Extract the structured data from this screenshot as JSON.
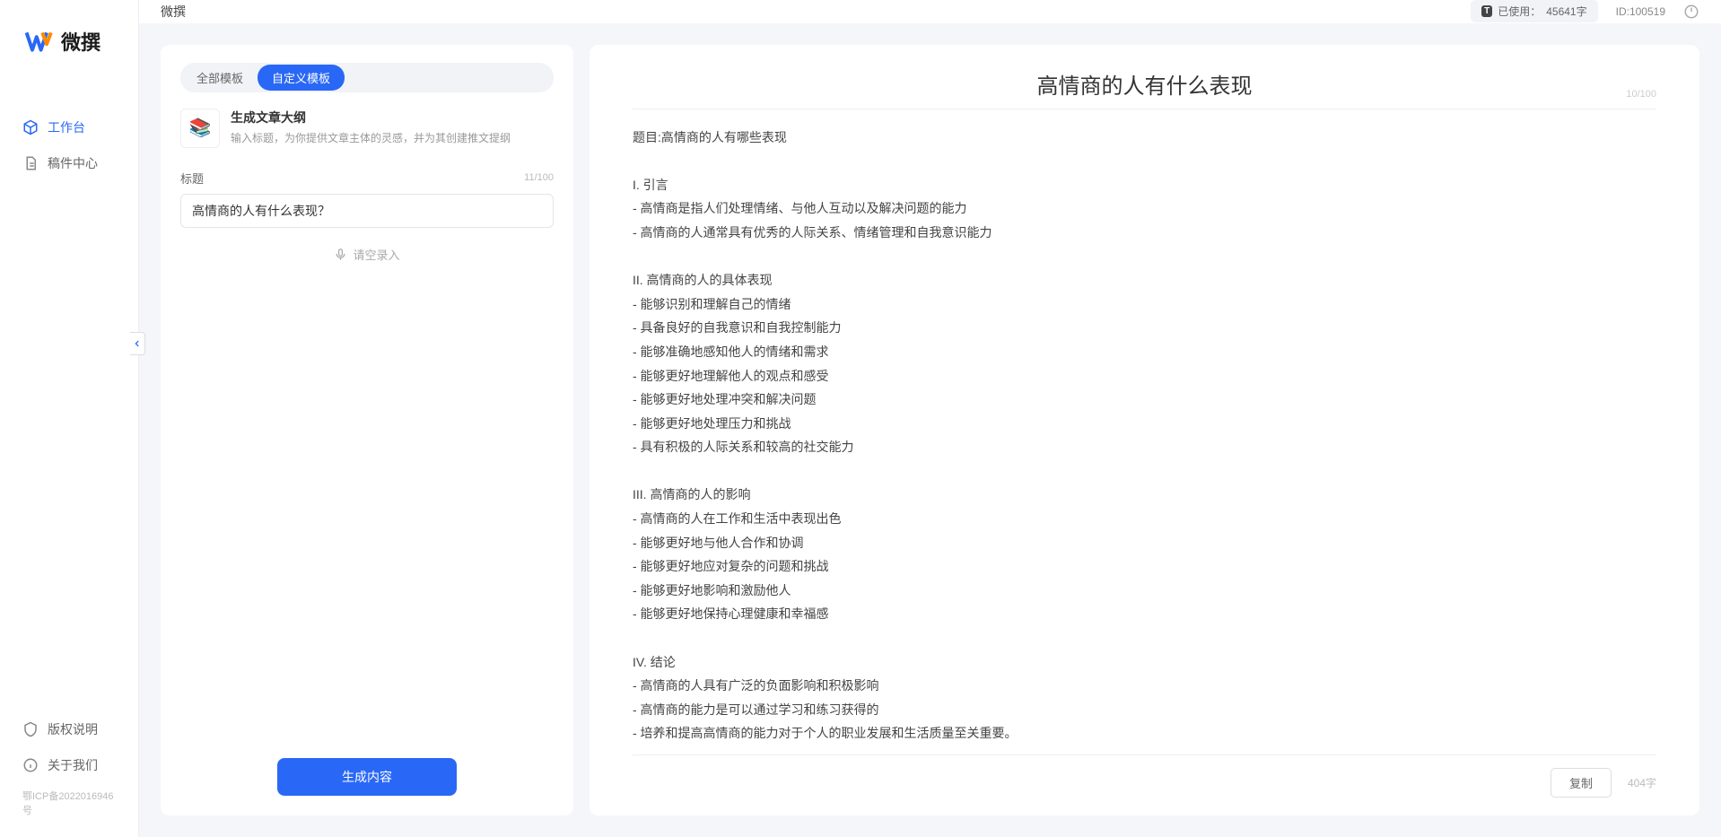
{
  "brand": {
    "name": "微撰"
  },
  "sidebar": {
    "items": [
      {
        "label": "工作台",
        "active": true
      },
      {
        "label": "稿件中心",
        "active": false
      }
    ],
    "bottom": [
      {
        "label": "版权说明"
      },
      {
        "label": "关于我们"
      }
    ],
    "icp": "鄂ICP备2022016946号"
  },
  "topbar": {
    "title": "微撰",
    "usage_label": "已使用：",
    "usage_value": "45641字",
    "uid_label": "ID:",
    "uid_value": "100519"
  },
  "left": {
    "tabs": [
      {
        "label": "全部模板",
        "active": false
      },
      {
        "label": "自定义模板",
        "active": true
      }
    ],
    "template": {
      "icon": "📚",
      "title": "生成文章大纲",
      "desc": "输入标题，为你提供文章主体的灵感，并为其创建推文提纲"
    },
    "field_label": "标题",
    "counter": "11/100",
    "input_value": "高情商的人有什么表现？",
    "voice_label": "请空录入",
    "generate_label": "生成内容"
  },
  "right": {
    "title": "高情商的人有什么表现",
    "title_counter": "10/100",
    "body": "题目:高情商的人有哪些表现\n\nI. 引言\n- 高情商是指人们处理情绪、与他人互动以及解决问题的能力\n- 高情商的人通常具有优秀的人际关系、情绪管理和自我意识能力\n\nII. 高情商的人的具体表现\n- 能够识别和理解自己的情绪\n- 具备良好的自我意识和自我控制能力\n- 能够准确地感知他人的情绪和需求\n- 能够更好地理解他人的观点和感受\n- 能够更好地处理冲突和解决问题\n- 能够更好地处理压力和挑战\n- 具有积极的人际关系和较高的社交能力\n\nIII. 高情商的人的影响\n- 高情商的人在工作和生活中表现出色\n- 能够更好地与他人合作和协调\n- 能够更好地应对复杂的问题和挑战\n- 能够更好地影响和激励他人\n- 能够更好地保持心理健康和幸福感\n\nIV. 结论\n- 高情商的人具有广泛的负面影响和积极影响\n- 高情商的能力是可以通过学习和练习获得的\n- 培养和提高高情商的能力对于个人的职业发展和生活质量至关重要。",
    "copy_label": "复制",
    "char_count": "404字"
  }
}
